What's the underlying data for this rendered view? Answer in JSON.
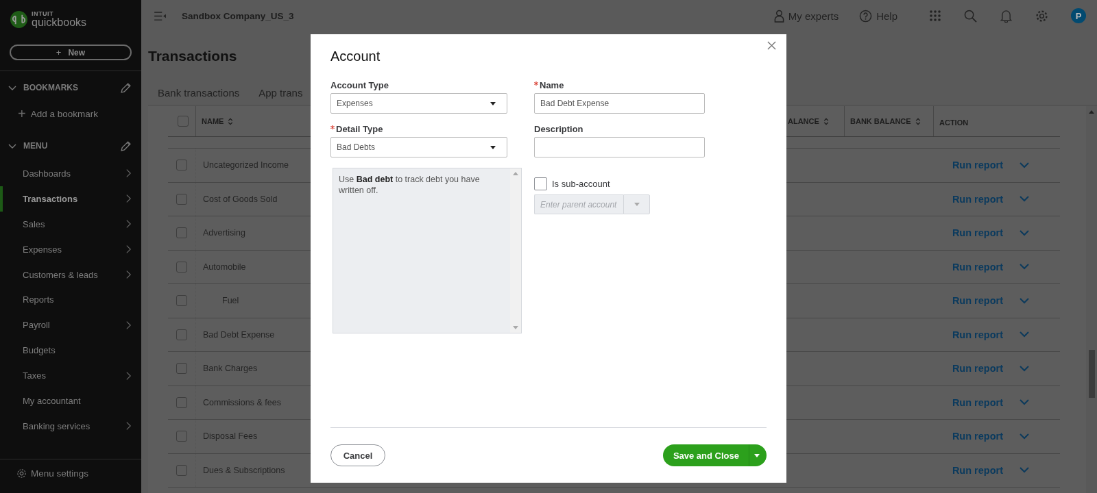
{
  "top_bar": {
    "company": "Sandbox Company_US_3",
    "links": [
      {
        "label": "My experts",
        "kind": "experts"
      },
      {
        "label": "Help",
        "kind": "help"
      }
    ],
    "avatar": "P"
  },
  "sidebar": {
    "brand_top": "INTUIT",
    "brand": "quickbooks",
    "new_button": {
      "icon": "+",
      "label": "New"
    },
    "bookmarks": {
      "heading": "BOOKMARKS",
      "expanded": true,
      "add": "Add a bookmark"
    },
    "menu": {
      "heading": "MENU",
      "expanded": true,
      "items": [
        {
          "label": "Dashboards",
          "selected": false,
          "has_submenu": true
        },
        {
          "label": "Transactions",
          "selected": true,
          "has_submenu": true
        },
        {
          "label": "Sales",
          "selected": false,
          "has_submenu": true
        },
        {
          "label": "Expenses",
          "selected": false,
          "has_submenu": true
        },
        {
          "label": "Customers & leads",
          "selected": false,
          "has_submenu": true
        },
        {
          "label": "Reports",
          "selected": false,
          "has_submenu": false
        },
        {
          "label": "Payroll",
          "selected": false,
          "has_submenu": true
        },
        {
          "label": "Budgets",
          "selected": false,
          "has_submenu": false
        },
        {
          "label": "Taxes",
          "selected": false,
          "has_submenu": true
        },
        {
          "label": "My accountant",
          "selected": false,
          "has_submenu": false
        },
        {
          "label": "Banking services",
          "selected": false,
          "has_submenu": true
        }
      ]
    },
    "settings": "Menu settings"
  },
  "page": {
    "title": "Transactions",
    "tabs": [
      {
        "label": "Bank transactions",
        "selected": false
      },
      {
        "label": "App trans",
        "selected": false
      }
    ]
  },
  "table": {
    "all_checked": false,
    "columns": [
      {
        "label": "NAME",
        "sortable": true
      },
      {
        "label": "ALANCE",
        "sortable": true
      },
      {
        "label": "BANK BALANCE",
        "sortable": true
      },
      {
        "label": "ACTION",
        "sortable": false
      }
    ],
    "rows": [
      {
        "name": "Uncategorized Income",
        "checked": false,
        "action": "Run report"
      },
      {
        "name": "Cost of Goods Sold",
        "checked": false,
        "action": "Run report"
      },
      {
        "name": "Advertising",
        "checked": false,
        "action": "Run report"
      },
      {
        "name": "Automobile",
        "checked": false,
        "action": "Run report",
        "children": [
          {
            "name": "Fuel",
            "checked": false,
            "action": "Run report"
          }
        ]
      },
      {
        "name": "Bad Debt Expense",
        "checked": false,
        "action": "Run report"
      },
      {
        "name": "Bank Charges",
        "checked": false,
        "action": "Run report"
      },
      {
        "name": "Commissions & fees",
        "checked": false,
        "action": "Run report"
      },
      {
        "name": "Disposal Fees",
        "checked": false,
        "action": "Run report"
      },
      {
        "name": "Dues & Subscriptions",
        "checked": false,
        "action": "Run report"
      }
    ]
  },
  "dialog": {
    "title": "Account",
    "account_type": {
      "label": "Account Type",
      "value": "Expenses",
      "required": false
    },
    "name": {
      "label": "Name",
      "value": "Bad Debt Expense",
      "required": true
    },
    "detail_type": {
      "label": "Detail Type",
      "value": "Bad Debts",
      "required": true
    },
    "description": {
      "label": "Description",
      "required": false
    },
    "help_text": "Use **Bad debt** to track debt you have written off.",
    "sub_account": {
      "label": "Is sub-account",
      "checked": false
    },
    "parent_account": {
      "placeholder": "Enter parent account",
      "disabled": true
    },
    "cancel": "Cancel",
    "save": "Save and Close"
  }
}
